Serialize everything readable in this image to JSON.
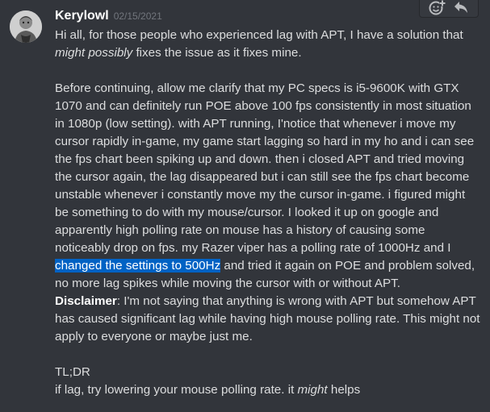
{
  "message": {
    "author": "Kerylowl",
    "timestamp": "02/15/2021",
    "p1_pre": "Hi all, for those people who experienced lag with APT, I have a solution that ",
    "p1_em": "might possibly",
    "p1_post": " fixes the issue as it fixes mine.",
    "p2_pre": "Before continuing, allow me clarify that my PC specs is i5-9600K with GTX 1070 and can definitely run POE above 100 fps consistently in most situation in 1080p (low setting). with APT running, I'notice that whenever i  move my cursor rapidly in-game, my game start lagging so hard in my ho and i can see the fps chart been spiking up and down. then i closed APT and tried moving the cursor again, the lag disappeared but i can still see the fps chart become unstable whenever i constantly move my the cursor in-game. i figured might be something to do with my mouse/cursor. I looked it up on google and apparently high polling rate on mouse has a history of causing some noticeably drop on fps. my Razer viper has a polling rate of 1000Hz and I ",
    "p2_selected": "changed the settings to 500Hz",
    "p2_post": " and tried it again on POE and problem solved, no more lag spikes while moving the cursor with or without APT.",
    "disclaimer_label": "Disclaimer",
    "disclaimer_text": ": I'm not saying that anything is wrong with APT but somehow APT has caused significant lag while having high mouse polling rate. This might not apply to everyone or maybe just me.",
    "tldr_label": "TL;DR",
    "tldr_pre": "if lag, try lowering your mouse polling rate. it ",
    "tldr_em": "might",
    "tldr_post": " helps"
  },
  "toolbar": {
    "icons": [
      "add-reaction-icon",
      "reply-icon"
    ]
  },
  "colors": {
    "background": "#32353b",
    "text": "#dcddde",
    "username": "#ffffff",
    "timestamp": "#72767d",
    "selection": "#0062c4"
  }
}
